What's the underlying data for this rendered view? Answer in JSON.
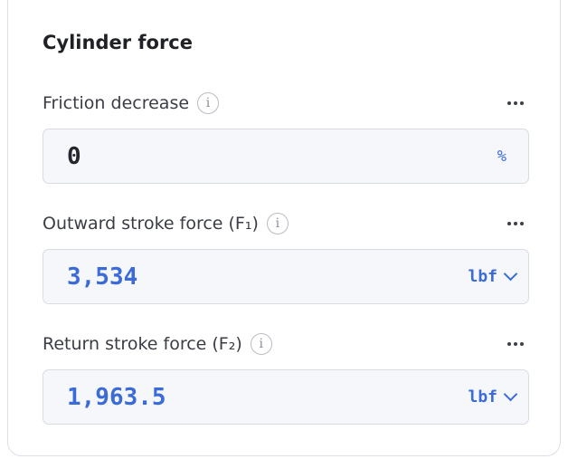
{
  "card": {
    "title": "Cylinder force"
  },
  "fields": [
    {
      "label": "Friction decrease",
      "info_glyph": "i",
      "value": "0",
      "unit": "%"
    },
    {
      "label": "Outward stroke force (F₁)",
      "info_glyph": "i",
      "value": "3,534",
      "unit": "lbf"
    },
    {
      "label": "Return stroke force (F₂)",
      "info_glyph": "i",
      "value": "1,963.5",
      "unit": "lbf"
    }
  ],
  "colors": {
    "accent": "#3b6bd8",
    "input_background": "#f5f7fb",
    "border": "#d8dbe2",
    "title_text": "#1f2126"
  },
  "icons": {
    "info": "info-circle-icon",
    "more": "more-horizontal-icon",
    "dropdown": "chevron-down-icon"
  }
}
